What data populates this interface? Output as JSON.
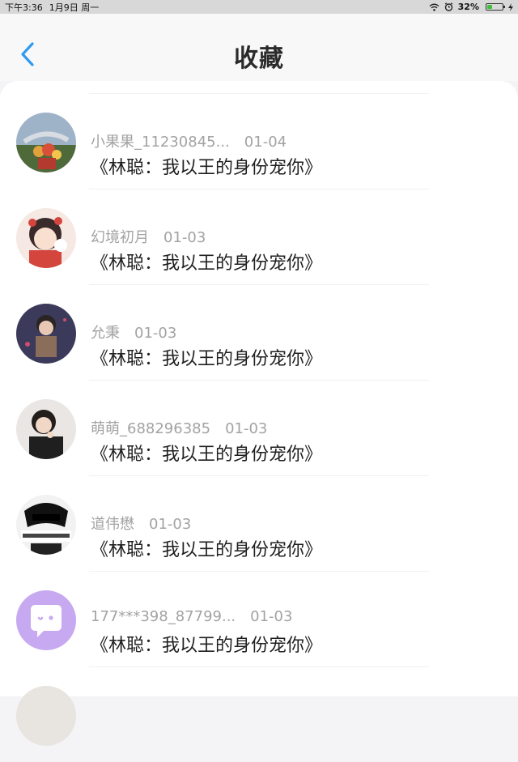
{
  "status_bar": {
    "time": "下午3:36",
    "date": "1月9日 周一",
    "battery": "32%"
  },
  "header": {
    "title": "收藏",
    "back_icon": "chevron-left-icon"
  },
  "colors": {
    "accent": "#2f9bf0",
    "battery_fill": "#3cc23c"
  },
  "favorites": [
    {
      "user": "小果果_11230845...",
      "date": "01-04",
      "title": "《林聪：我以王的身份宠你》"
    },
    {
      "user": "幻境初月",
      "date": "01-03",
      "title": "《林聪：我以王的身份宠你》"
    },
    {
      "user": "允秉",
      "date": "01-03",
      "title": "《林聪：我以王的身份宠你》"
    },
    {
      "user": "萌萌_688296385",
      "date": "01-03",
      "title": "《林聪：我以王的身份宠你》"
    },
    {
      "user": "道伟懋",
      "date": "01-03",
      "title": "《林聪：我以王的身份宠你》"
    },
    {
      "user": "177***398_87799...",
      "date": "01-03",
      "title": "《林聪：我以王的身份宠你》"
    }
  ]
}
